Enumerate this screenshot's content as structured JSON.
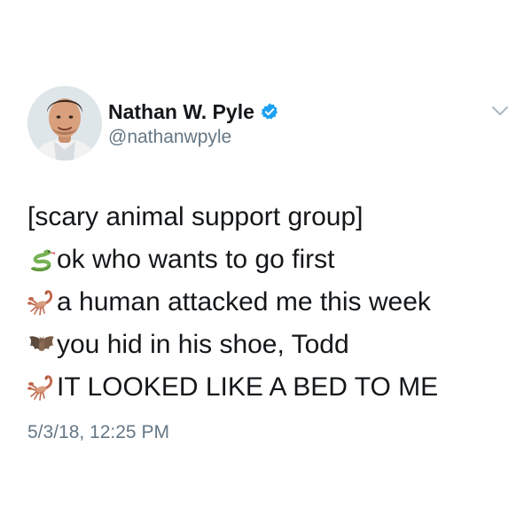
{
  "tweet": {
    "author": {
      "display_name": "Nathan W. Pyle",
      "handle": "@nathanwpyle",
      "verified": true,
      "verified_icon": "verified-badge-icon",
      "verified_color": "#1da1f2"
    },
    "menu_icon": "chevron-down-icon",
    "lines": [
      {
        "emoji": "",
        "text": "[scary animal support group]"
      },
      {
        "emoji": "snake-icon",
        "text": "ok who wants to go first"
      },
      {
        "emoji": "scorpion-icon",
        "text": "a human attacked me this week"
      },
      {
        "emoji": "bat-icon",
        "text": "you hid in his shoe, Todd"
      },
      {
        "emoji": "scorpion-icon",
        "text": "IT LOOKED LIKE A BED TO ME"
      }
    ],
    "timestamp": "5/3/18, 12:25 PM"
  },
  "colors": {
    "text": "#14171a",
    "secondary_text": "#657786",
    "background": "#ffffff"
  }
}
